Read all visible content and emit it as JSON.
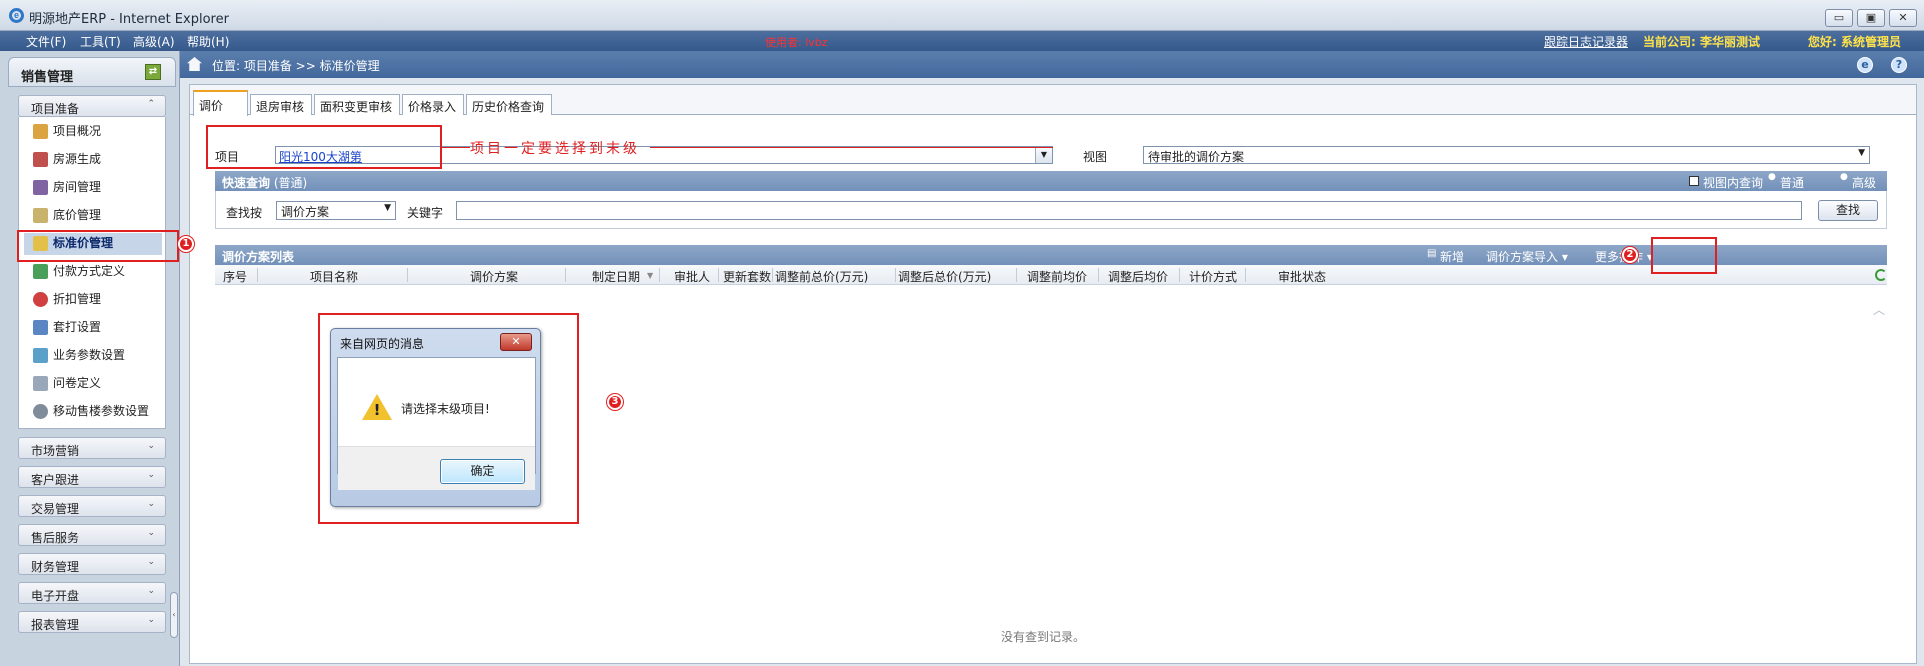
{
  "window": {
    "title": "明源地产ERP - Internet Explorer",
    "min": "▭",
    "max": "▣",
    "close": "✕"
  },
  "menu": {
    "items": [
      "文件(F)",
      "工具(T)",
      "高级(A)",
      "帮助(H)"
    ],
    "user": "使用者: lvbz",
    "log": "跟踪日志记录器",
    "company": "当前公司: 李华丽测试",
    "greeting": "您好: 系统管理员"
  },
  "sidebar": {
    "title": "销售管理",
    "open_group": "项目准备",
    "items": [
      "项目概况",
      "房源生成",
      "房间管理",
      "底价管理",
      "标准价管理",
      "付款方式定义",
      "折扣管理",
      "套打设置",
      "业务参数设置",
      "问卷定义",
      "移动售楼参数设置"
    ],
    "active_item": "标准价管理",
    "groups": [
      "市场营销",
      "客户跟进",
      "交易管理",
      "售后服务",
      "财务管理",
      "电子开盘",
      "报表管理"
    ]
  },
  "breadcrumb": "位置: 项目准备 >> 标准价管理",
  "tabs": [
    "调价",
    "退房审核",
    "面积变更审核",
    "价格录入",
    "历史价格查询"
  ],
  "active_tab": "调价",
  "filter": {
    "project_label": "项目",
    "project_value": "阳光100大湖第",
    "view_label": "视图",
    "view_value": "待审批的调价方案"
  },
  "quick": {
    "title": "快速查询",
    "mode": "(普通)",
    "in_view": "视图内查询",
    "normal": "普通",
    "advanced": "高级",
    "find_by_label": "查找按",
    "find_by_value": "调价方案",
    "keyword_label": "关键字",
    "search_button": "查找"
  },
  "list": {
    "title": "调价方案列表",
    "new_button": "新增",
    "import_button": "调价方案导入 ▾",
    "more_button": "更多操作 ▾",
    "columns": [
      "序号",
      "项目名称",
      "调价方案",
      "制定日期",
      "审批人",
      "更新套数",
      "调整前总价(万元)",
      "调整后总价(万元)",
      "调整前均价",
      "调整后均价",
      "计价方式",
      "审批状态"
    ],
    "empty": "没有查到记录。"
  },
  "annotation": {
    "text": "项目一定要选择到末级",
    "badges": [
      "1",
      "2",
      "3"
    ]
  },
  "dialog": {
    "title": "来自网页的消息",
    "message": "请选择末级项目!",
    "ok": "确定"
  },
  "colors": {
    "accent": "#42679b",
    "annotation": "#e02020",
    "link": "#1a44c8"
  }
}
